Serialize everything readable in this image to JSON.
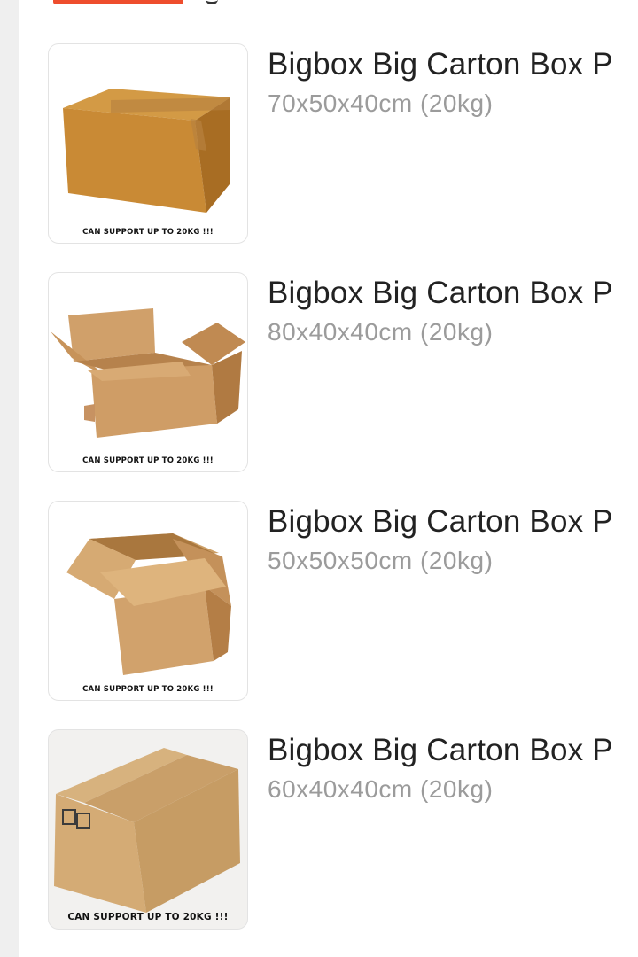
{
  "header": {
    "active_tab_color": "#ee4d2d"
  },
  "variants": [
    {
      "title": "Bigbox Big Carton Box P",
      "size": "70x50x40cm (20kg)",
      "caption": "CAN SUPPORT UP TO 20KG !!!",
      "image": "closed-taped-carton-box"
    },
    {
      "title": "Bigbox Big Carton Box P",
      "size": "80x40x40cm (20kg)",
      "caption": "CAN SUPPORT UP TO 20KG !!!",
      "image": "open-flaps-carton-box"
    },
    {
      "title": "Bigbox Big Carton Box P",
      "size": "50x50x50cm (20kg)",
      "caption": "CAN SUPPORT UP TO 20KG !!!",
      "image": "open-cube-carton-box"
    },
    {
      "title": "Bigbox Big Carton Box P",
      "size": "60x40x40cm (20kg)",
      "caption": "CAN SUPPORT UP TO 20KG !!!",
      "image": "half-closed-carton-box"
    }
  ]
}
